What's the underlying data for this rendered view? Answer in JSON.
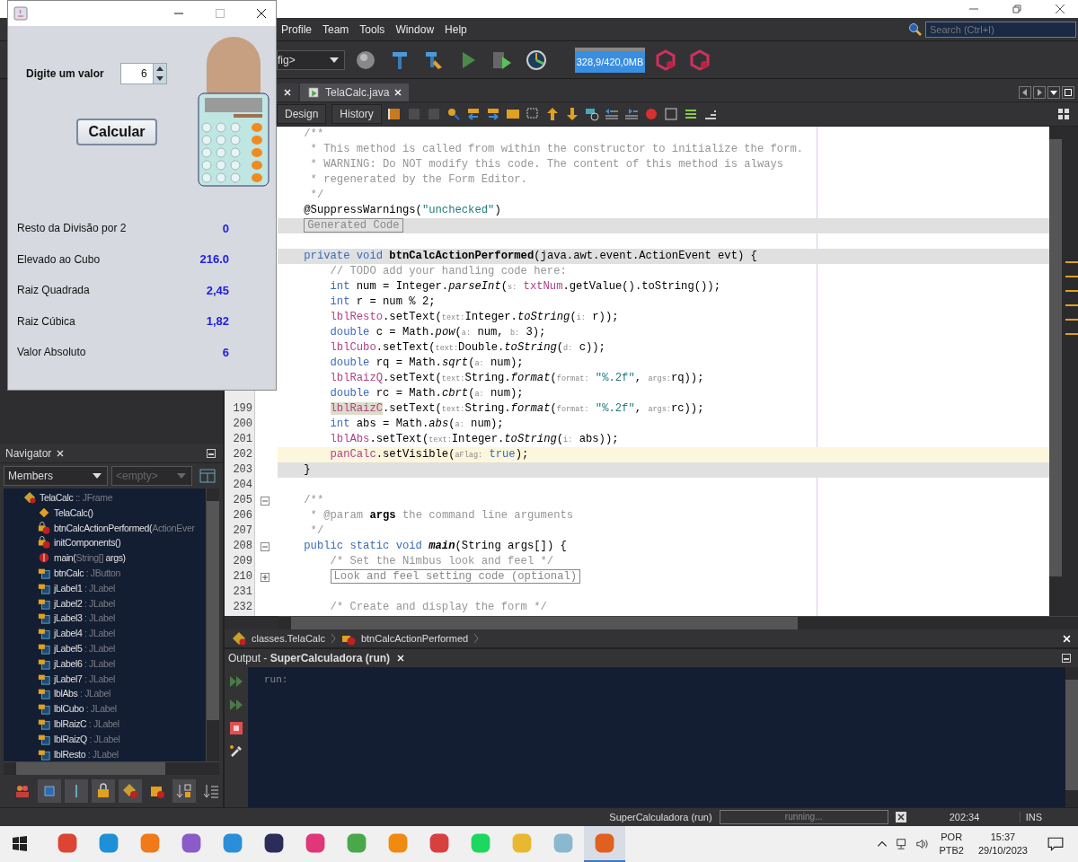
{
  "ide": {
    "menus": [
      "Profile",
      "Team",
      "Tools",
      "Window",
      "Help"
    ],
    "search": {
      "placeholder": "Search (Ctrl+I)"
    },
    "config": "fig>",
    "memory": "328,9/420,0MB",
    "editor_tabs": [
      {
        "selected": false
      },
      {
        "label": "TelaCalc.java",
        "selected": true
      }
    ],
    "editor_modes": [
      "Design",
      "History"
    ],
    "code": [
      {
        "kind": "plain",
        "parts": [
          {
            "kind": "comment",
            "text": "    /**"
          }
        ]
      },
      {
        "kind": "plain",
        "parts": [
          {
            "kind": "comment",
            "text": "     * This method is called from within the constructor to initialize the form."
          }
        ]
      },
      {
        "kind": "plain",
        "parts": [
          {
            "kind": "comment",
            "text": "     * WARNING: Do NOT modify this code. The content of this method is always"
          }
        ]
      },
      {
        "kind": "plain",
        "parts": [
          {
            "kind": "comment",
            "text": "     * regenerated by the Form Editor."
          }
        ]
      },
      {
        "kind": "plain",
        "parts": [
          {
            "kind": "comment",
            "text": "     */"
          }
        ]
      },
      {
        "kind": "plain",
        "parts": [
          {
            "kind": "plain",
            "text": "    @SuppressWarnings("
          },
          {
            "kind": "string",
            "text": "\"unchecked\""
          },
          {
            "kind": "plain",
            "text": ")"
          }
        ]
      },
      {
        "kind": "fold",
        "parts": [
          {
            "kind": "folded",
            "text": "    Generated Code"
          }
        ]
      },
      {
        "kind": "plain"
      },
      {
        "kind": "fold",
        "parts": [
          {
            "kind": "keyword",
            "text": "    private void "
          },
          {
            "kind": "bold",
            "text": "btnCalcActionPerformed"
          },
          {
            "kind": "plain",
            "text": "(java.awt.event.ActionEvent evt) {"
          }
        ]
      },
      {
        "kind": "plain",
        "parts": [
          {
            "kind": "comment",
            "text": "        // TODO add your handling code here:"
          }
        ]
      },
      {
        "kind": "plain",
        "parts": [
          {
            "kind": "keyword",
            "text": "        int"
          },
          {
            "kind": "plain",
            "text": " num = Integer."
          },
          {
            "kind": "static",
            "text": "parseInt"
          },
          {
            "kind": "plain",
            "text": "("
          },
          {
            "kind": "hint",
            "text": "s:"
          },
          {
            "kind": "field",
            "text": " txtNum"
          },
          {
            "kind": "plain",
            "text": ".getValue().toString());"
          }
        ]
      },
      {
        "kind": "plain",
        "parts": [
          {
            "kind": "keyword",
            "text": "        int"
          },
          {
            "kind": "plain",
            "text": " r = num % 2;"
          }
        ]
      },
      {
        "kind": "plain",
        "parts": [
          {
            "kind": "field",
            "text": "        lblResto"
          },
          {
            "kind": "plain",
            "text": ".setText("
          },
          {
            "kind": "hint",
            "text": "text:"
          },
          {
            "kind": "plain",
            "text": "Integer."
          },
          {
            "kind": "static",
            "text": "toString"
          },
          {
            "kind": "plain",
            "text": "("
          },
          {
            "kind": "hint",
            "text": "i:"
          },
          {
            "kind": "plain",
            "text": " r));"
          }
        ]
      },
      {
        "kind": "plain",
        "parts": [
          {
            "kind": "keyword",
            "text": "        double"
          },
          {
            "kind": "plain",
            "text": " c = Math."
          },
          {
            "kind": "static",
            "text": "pow"
          },
          {
            "kind": "plain",
            "text": "("
          },
          {
            "kind": "hint",
            "text": "a:"
          },
          {
            "kind": "plain",
            "text": " num, "
          },
          {
            "kind": "hint",
            "text": "b:"
          },
          {
            "kind": "plain",
            "text": " 3);"
          }
        ]
      },
      {
        "kind": "plain",
        "parts": [
          {
            "kind": "field",
            "text": "        lblCubo"
          },
          {
            "kind": "plain",
            "text": ".setText("
          },
          {
            "kind": "hint",
            "text": "text:"
          },
          {
            "kind": "plain",
            "text": "Double."
          },
          {
            "kind": "static",
            "text": "toString"
          },
          {
            "kind": "plain",
            "text": "("
          },
          {
            "kind": "hint",
            "text": "d:"
          },
          {
            "kind": "plain",
            "text": " c));"
          }
        ]
      },
      {
        "kind": "plain",
        "parts": [
          {
            "kind": "keyword",
            "text": "        double"
          },
          {
            "kind": "plain",
            "text": " rq = Math."
          },
          {
            "kind": "static",
            "text": "sqrt"
          },
          {
            "kind": "plain",
            "text": "("
          },
          {
            "kind": "hint",
            "text": "a:"
          },
          {
            "kind": "plain",
            "text": " num);"
          }
        ]
      },
      {
        "kind": "plain",
        "parts": [
          {
            "kind": "field",
            "text": "        lblRaizQ"
          },
          {
            "kind": "plain",
            "text": ".setText("
          },
          {
            "kind": "hint",
            "text": "text:"
          },
          {
            "kind": "plain",
            "text": "String."
          },
          {
            "kind": "static",
            "text": "format"
          },
          {
            "kind": "plain",
            "text": "("
          },
          {
            "kind": "hint",
            "text": "format:"
          },
          {
            "kind": "string",
            "text": " \"%.2f\""
          },
          {
            "kind": "plain",
            "text": ", "
          },
          {
            "kind": "hint",
            "text": "args:"
          },
          {
            "kind": "plain",
            "text": "rq));"
          }
        ]
      },
      {
        "kind": "plain",
        "parts": [
          {
            "kind": "keyword",
            "text": "        double"
          },
          {
            "kind": "plain",
            "text": " rc = Math."
          },
          {
            "kind": "static",
            "text": "cbrt"
          },
          {
            "kind": "plain",
            "text": "("
          },
          {
            "kind": "hint",
            "text": "a:"
          },
          {
            "kind": "plain",
            "text": " num);"
          }
        ]
      },
      {
        "kind": "plain",
        "n": "199",
        "parts": [
          {
            "kind": "marked",
            "text": "        lblRaizC"
          },
          {
            "kind": "plain",
            "text": ".setText("
          },
          {
            "kind": "hint",
            "text": "text:"
          },
          {
            "kind": "plain",
            "text": "String."
          },
          {
            "kind": "static",
            "text": "format"
          },
          {
            "kind": "plain",
            "text": "("
          },
          {
            "kind": "hint",
            "text": "format:"
          },
          {
            "kind": "string",
            "text": " \"%.2f\""
          },
          {
            "kind": "plain",
            "text": ", "
          },
          {
            "kind": "hint",
            "text": "args:"
          },
          {
            "kind": "plain",
            "text": "rc));"
          }
        ]
      },
      {
        "kind": "plain",
        "n": "200",
        "parts": [
          {
            "kind": "keyword",
            "text": "        int"
          },
          {
            "kind": "plain",
            "text": " abs = Math."
          },
          {
            "kind": "static",
            "text": "abs"
          },
          {
            "kind": "plain",
            "text": "("
          },
          {
            "kind": "hint",
            "text": "a:"
          },
          {
            "kind": "plain",
            "text": " num);"
          }
        ]
      },
      {
        "kind": "plain",
        "n": "201",
        "parts": [
          {
            "kind": "field",
            "text": "        lblAbs"
          },
          {
            "kind": "plain",
            "text": ".setText("
          },
          {
            "kind": "hint",
            "text": "text:"
          },
          {
            "kind": "plain",
            "text": "Integer."
          },
          {
            "kind": "static",
            "text": "toString"
          },
          {
            "kind": "plain",
            "text": "("
          },
          {
            "kind": "hint",
            "text": "i:"
          },
          {
            "kind": "plain",
            "text": " abs));"
          }
        ]
      },
      {
        "kind": "current",
        "n": "202",
        "parts": [
          {
            "kind": "field",
            "text": "        panCalc"
          },
          {
            "kind": "plain",
            "text": ".setVisible("
          },
          {
            "kind": "hint",
            "text": "aFlag:"
          },
          {
            "kind": "keyword",
            "text": " true"
          },
          {
            "kind": "plain",
            "text": ");"
          }
        ]
      },
      {
        "kind": "fold",
        "n": "203",
        "parts": [
          {
            "kind": "plain",
            "text": "    }"
          }
        ]
      },
      {
        "kind": "plain",
        "n": "204"
      },
      {
        "kind": "plain",
        "n": "205",
        "expanded": true,
        "parts": [
          {
            "kind": "comment",
            "text": "    /**"
          }
        ]
      },
      {
        "kind": "plain",
        "n": "206",
        "parts": [
          {
            "kind": "comment",
            "text": "     * @param "
          },
          {
            "kind": "bold",
            "text": "args"
          },
          {
            "kind": "comment",
            "text": " the command line arguments"
          }
        ]
      },
      {
        "kind": "plain",
        "n": "207",
        "parts": [
          {
            "kind": "comment",
            "text": "     */"
          }
        ]
      },
      {
        "kind": "plain",
        "n": "208",
        "expanded": true,
        "parts": [
          {
            "kind": "keyword",
            "text": "    public static void "
          },
          {
            "kind": "bolditalic",
            "text": "main"
          },
          {
            "kind": "plain",
            "text": "(String args[]) {"
          }
        ]
      },
      {
        "kind": "plain",
        "n": "209",
        "parts": [
          {
            "kind": "comment",
            "text": "        /* Set the Nimbus look and feel */"
          }
        ]
      },
      {
        "kind": "plain",
        "n": "210",
        "expanded": false,
        "parts": [
          {
            "kind": "folded",
            "text": "        Look and feel setting code (optional)"
          }
        ]
      },
      {
        "kind": "plain",
        "n": "231"
      },
      {
        "kind": "plain",
        "n": "232",
        "parts": [
          {
            "kind": "comment",
            "text": "        /* Create and display the form */"
          }
        ]
      }
    ],
    "breadcrumb": [
      "classes.TelaCalc",
      "btnCalcActionPerformed"
    ],
    "navigator": {
      "title": "Navigator",
      "filter": "Members",
      "filter_2": "<empty>",
      "tree": {
        "name": "TelaCalc",
        "detail": " :: JFrame",
        "kind": "class",
        "children": [
          {
            "name": "TelaCalc()",
            "kind": "constructor"
          },
          {
            "name": "btnCalcActionPerformed(",
            "detail": "ActionEver",
            "kind": "private-method"
          },
          {
            "name": "initComponents()",
            "kind": "private-method"
          },
          {
            "name": "main(",
            "detail": "String[]",
            "suffix": " args)",
            "kind": "static-method"
          },
          {
            "name": "btnCalc",
            "detail": " : JButton",
            "kind": "private-field"
          },
          {
            "name": "jLabel1",
            "detail": " : JLabel",
            "kind": "private-field"
          },
          {
            "name": "jLabel2",
            "detail": " : JLabel",
            "kind": "private-field"
          },
          {
            "name": "jLabel3",
            "detail": " : JLabel",
            "kind": "private-field"
          },
          {
            "name": "jLabel4",
            "detail": " : JLabel",
            "kind": "private-field"
          },
          {
            "name": "jLabel5",
            "detail": " : JLabel",
            "kind": "private-field"
          },
          {
            "name": "jLabel6",
            "detail": " : JLabel",
            "kind": "private-field"
          },
          {
            "name": "jLabel7",
            "detail": " : JLabel",
            "kind": "private-field"
          },
          {
            "name": "lblAbs",
            "detail": " : JLabel",
            "kind": "private-field"
          },
          {
            "name": "lblCubo",
            "detail": " : JLabel",
            "kind": "private-field"
          },
          {
            "name": "lblRaizC",
            "detail": " : JLabel",
            "kind": "private-field"
          },
          {
            "name": "lblRaizQ",
            "detail": " : JLabel",
            "kind": "private-field"
          },
          {
            "name": "lblResto",
            "detail": " : JLabel",
            "kind": "private-field"
          }
        ]
      }
    },
    "output": {
      "title": "Output - **SuperCalculadora (run)**",
      "text": "run:"
    },
    "status": {
      "task": "SuperCalculadora (run)",
      "progress": "running...",
      "position": "202:34",
      "mode": "INS"
    }
  },
  "app": {
    "prompt": "Digite um valor",
    "value": "6",
    "button": "Calcular",
    "results": [
      {
        "label": "Resto da Divisão por 2",
        "value": "0"
      },
      {
        "label": "Elevado ao Cubo",
        "value": "216.0"
      },
      {
        "label": "Raiz Quadrada",
        "value": "2,45"
      },
      {
        "label": "Raiz Cúbica",
        "value": "1,82"
      },
      {
        "label": "Valor Absoluto",
        "value": "6"
      }
    ]
  },
  "taskbar": {
    "apps": [
      {
        "color": "#dd4433",
        "selected": false
      },
      {
        "color": "#1e90d8",
        "selected": false
      },
      {
        "color": "#f07a1a",
        "selected": false
      },
      {
        "color": "#8a5cc8",
        "selected": false
      },
      {
        "color": "#2a8fd8",
        "selected": false
      },
      {
        "color": "#2c2c5a",
        "selected": false
      },
      {
        "color": "#e0367a",
        "selected": false
      },
      {
        "color": "#4aa84a",
        "selected": false
      },
      {
        "color": "#f08a10",
        "selected": false
      },
      {
        "color": "#d84040",
        "selected": false
      },
      {
        "color": "#1ed760",
        "selected": false
      },
      {
        "color": "#e8b830",
        "selected": false
      },
      {
        "color": "#8ab8d0",
        "selected": false
      },
      {
        "color": "#e06020",
        "selected": true
      }
    ],
    "language": "POR",
    "layout": "PTB2",
    "time": "15:37",
    "date": "29/10/2023"
  }
}
